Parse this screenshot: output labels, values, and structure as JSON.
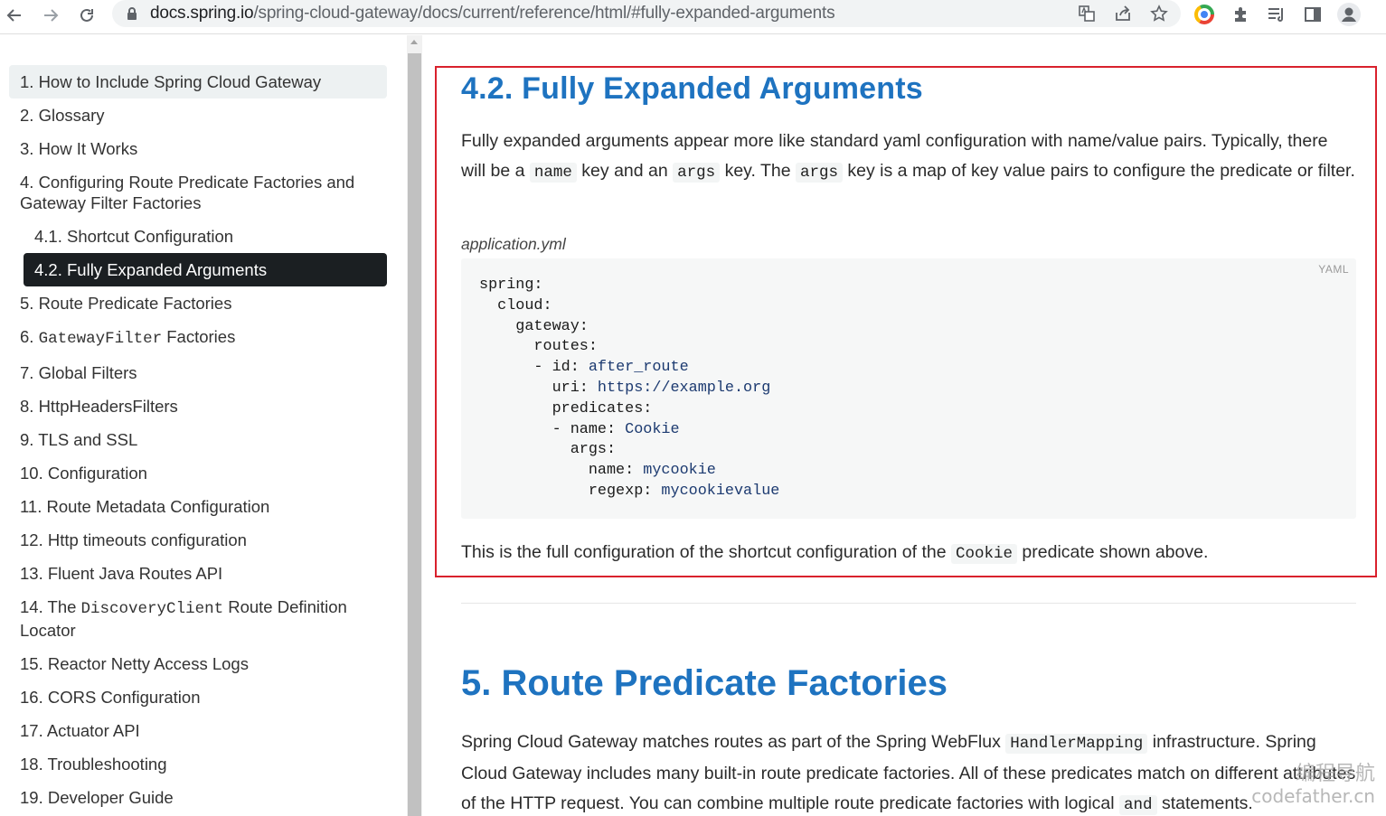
{
  "browser": {
    "url_host": "docs.spring.io",
    "url_path": "/spring-cloud-gateway/docs/current/reference/html/#fully-expanded-arguments"
  },
  "toc": {
    "items": [
      {
        "label": "1. How to Include Spring Cloud Gateway"
      },
      {
        "label": "2. Glossary"
      },
      {
        "label": "3. How It Works"
      },
      {
        "label": "4. Configuring Route Predicate Factories and Gateway Filter Factories"
      },
      {
        "label": "4.1. Shortcut Configuration"
      },
      {
        "label": "4.2. Fully Expanded Arguments"
      },
      {
        "label": "5. Route Predicate Factories"
      },
      {
        "pre": "6. ",
        "code": "GatewayFilter",
        "post": " Factories"
      },
      {
        "label": "7. Global Filters"
      },
      {
        "label": "8. HttpHeadersFilters"
      },
      {
        "label": "9. TLS and SSL"
      },
      {
        "label": "10. Configuration"
      },
      {
        "label": "11. Route Metadata Configuration"
      },
      {
        "label": "12. Http timeouts configuration"
      },
      {
        "label": "13. Fluent Java Routes API"
      },
      {
        "pre": "14. The ",
        "code": "DiscoveryClient",
        "post": " Route Definition Locator"
      },
      {
        "label": "15. Reactor Netty Access Logs"
      },
      {
        "label": "16. CORS Configuration"
      },
      {
        "label": "17. Actuator API"
      },
      {
        "label": "18. Troubleshooting"
      },
      {
        "label": "19. Developer Guide"
      }
    ]
  },
  "section_42": {
    "title": "4.2. Fully Expanded Arguments",
    "p1": {
      "t1": "Fully expanded arguments appear more like standard yaml configuration with name/value pairs. Typically, there will be a ",
      "c1": "name",
      "t2": " key and an ",
      "c2": "args",
      "t3": " key. The ",
      "c3": "args",
      "t4": " key is a map of key value pairs to configure the predicate or filter."
    },
    "caption": "application.yml",
    "code_lang": "YAML",
    "code": {
      "l1": "spring:",
      "l2": "  cloud:",
      "l3": "    gateway:",
      "l4": "      routes:",
      "l5k": "      - id: ",
      "l5v": "after_route",
      "l6k": "        uri: ",
      "l6v": "https://example.org",
      "l7": "        predicates:",
      "l8k": "        - name: ",
      "l8v": "Cookie",
      "l9": "          args:",
      "l10k": "            name: ",
      "l10v": "mycookie",
      "l11k": "            regexp: ",
      "l11v": "mycookievalue"
    },
    "p2": {
      "t1": "This is the full configuration of the shortcut configuration of the ",
      "c1": "Cookie",
      "t2": " predicate shown above."
    }
  },
  "section_5": {
    "title": "5. Route Predicate Factories",
    "p1": {
      "t1": "Spring Cloud Gateway matches routes as part of the Spring WebFlux ",
      "c1": "HandlerMapping",
      "t2": " infrastructure. Spring Cloud Gateway includes many built-in route predicate factories. All of these predicates match on different attributes of the HTTP request. You can combine multiple route predicate factories with logical ",
      "c2": "and",
      "t3": " statements."
    }
  },
  "watermark": {
    "line1": "编程导航",
    "line2": "codefather.cn"
  }
}
